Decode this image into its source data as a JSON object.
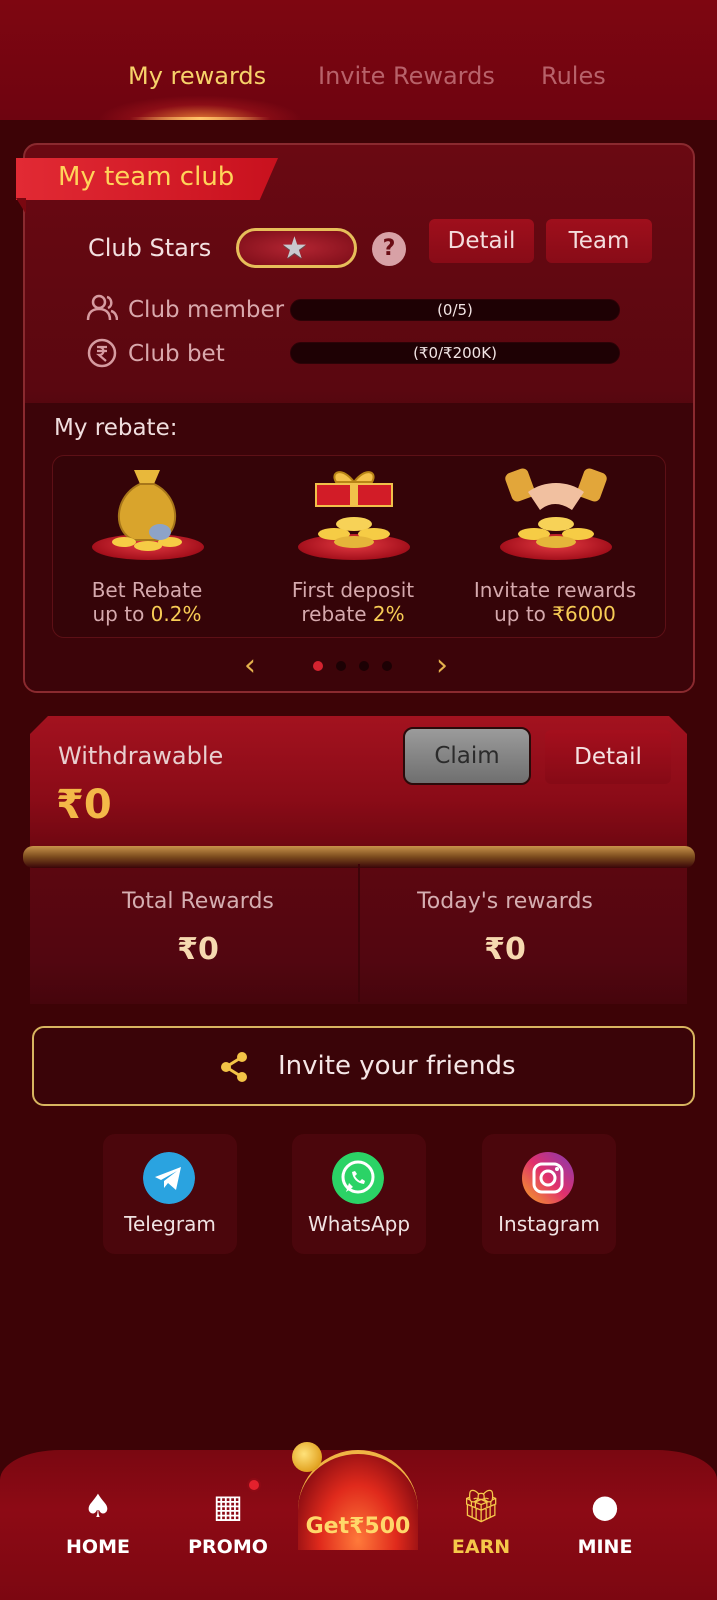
{
  "tabs": [
    {
      "label": "My rewards",
      "active": true
    },
    {
      "label": "Invite Rewards",
      "active": false
    },
    {
      "label": "Rules",
      "active": false
    }
  ],
  "club": {
    "title": "My team club",
    "stars_label": "Club Stars",
    "stars_count": 1,
    "detail_label": "Detail",
    "team_label": "Team",
    "member_label": "Club member",
    "member_progress": "(0/5)",
    "member_progress_value": 0,
    "bet_label": "Club bet",
    "bet_progress": "(₹0/₹200K)",
    "bet_progress_value": 0
  },
  "rebate": {
    "title": "My rebate:",
    "items": [
      {
        "line1": "Bet Rebate",
        "line2_prefix": "up to ",
        "line2_highlight": "0.2%",
        "icon": "money-bag-icon"
      },
      {
        "line1": "First deposit",
        "line2_prefix": "rebate ",
        "line2_highlight": "2%",
        "icon": "gift-box-icon"
      },
      {
        "line1": "Invitate rewards",
        "line2_prefix": "up to ",
        "line2_highlight": "₹6000",
        "icon": "handshake-icon"
      }
    ],
    "page_count": 4,
    "active_page": 0
  },
  "withdraw": {
    "title": "Withdrawable",
    "amount": "₹0",
    "claim_label": "Claim",
    "detail_label": "Detail"
  },
  "rewards": {
    "total_label": "Total Rewards",
    "total_value": "₹0",
    "today_label": "Today's rewards",
    "today_value": "₹0"
  },
  "invite": {
    "label": "Invite your friends"
  },
  "share": [
    {
      "label": "Telegram",
      "icon": "telegram-icon",
      "color": "#2aa3e0"
    },
    {
      "label": "WhatsApp",
      "icon": "whatsapp-icon",
      "color": "#2bd366"
    },
    {
      "label": "Instagram",
      "icon": "instagram-icon",
      "color": "#d6307a"
    }
  ],
  "nav": {
    "home": "HOME",
    "promo": "PROMO",
    "get": "Get₹500",
    "earn": "EARN",
    "mine": "MINE",
    "active": "earn"
  },
  "colors": {
    "accent_gold": "#f7d26a",
    "background": "#3d0306",
    "brand_red": "#c8111e"
  }
}
